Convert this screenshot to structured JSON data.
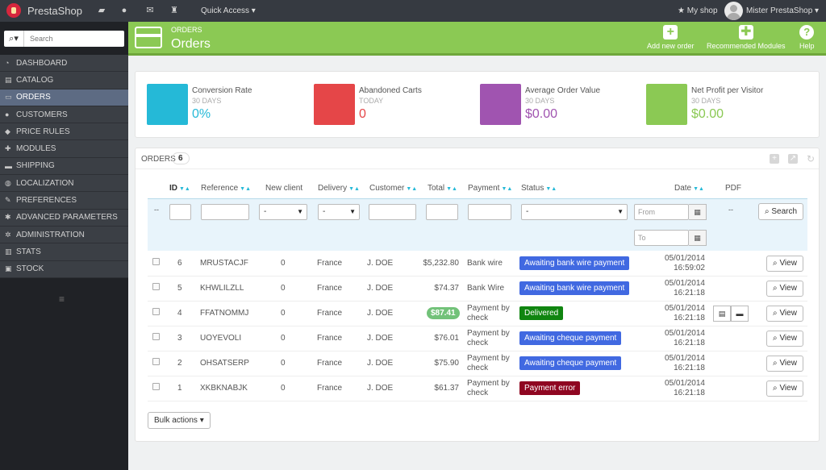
{
  "topbar": {
    "brand": "PrestaShop",
    "quick_access": "Quick Access ▾",
    "my_shop": "My shop",
    "user": "Mister PrestaShop ▾"
  },
  "sidebar": {
    "search_placeholder": "Search",
    "items": [
      {
        "label": "DASHBOARD",
        "icon": "speedometer-icon",
        "glyph": "◔"
      },
      {
        "label": "CATALOG",
        "icon": "catalog-icon",
        "glyph": "▤"
      },
      {
        "label": "ORDERS",
        "icon": "credit-card-icon",
        "glyph": "▭"
      },
      {
        "label": "CUSTOMERS",
        "icon": "users-icon",
        "glyph": "●"
      },
      {
        "label": "PRICE RULES",
        "icon": "tags-icon",
        "glyph": "◆"
      },
      {
        "label": "MODULES",
        "icon": "puzzle-icon",
        "glyph": "✚"
      },
      {
        "label": "SHIPPING",
        "icon": "truck-icon",
        "glyph": "▬"
      },
      {
        "label": "LOCALIZATION",
        "icon": "globe-icon",
        "glyph": "◍"
      },
      {
        "label": "PREFERENCES",
        "icon": "wrench-icon",
        "glyph": "✎"
      },
      {
        "label": "ADVANCED PARAMETERS",
        "icon": "cogs-icon",
        "glyph": "✱"
      },
      {
        "label": "ADMINISTRATION",
        "icon": "cog-icon",
        "glyph": "✲"
      },
      {
        "label": "STATS",
        "icon": "chart-icon",
        "glyph": "▥"
      },
      {
        "label": "STOCK",
        "icon": "archive-icon",
        "glyph": "▣"
      }
    ]
  },
  "header": {
    "breadcrumb": "ORDERS",
    "title": "Orders",
    "add_new": "Add new order",
    "recommended": "Recommended Modules",
    "help": "Help"
  },
  "kpis": [
    {
      "label": "Conversion Rate",
      "period": "30 DAYS",
      "value": "0%",
      "color": "#25b9d7"
    },
    {
      "label": "Abandoned Carts",
      "period": "TODAY",
      "value": "0",
      "color": "#e54648"
    },
    {
      "label": "Average Order Value",
      "period": "30 DAYS",
      "value": "$0.00",
      "color": "#a054b0"
    },
    {
      "label": "Net Profit per Visitor",
      "period": "30 DAYS",
      "value": "$0.00",
      "color": "#8bc954"
    }
  ],
  "orders": {
    "title": "ORDERS",
    "count": "6",
    "columns": {
      "id": "ID",
      "reference": "Reference",
      "new_client": "New client",
      "delivery": "Delivery",
      "customer": "Customer",
      "total": "Total",
      "payment": "Payment",
      "status": "Status",
      "date": "Date",
      "pdf": "PDF"
    },
    "filters": {
      "dash": "--",
      "select_default": "-",
      "from_placeholder": "From",
      "to_placeholder": "To",
      "search_label": "Search",
      "pdf_dash": "--"
    },
    "view_label": "View",
    "bulk_label": "Bulk actions ▾",
    "rows": [
      {
        "id": "6",
        "reference": "MRUSTACJF",
        "new_client": "0",
        "delivery": "France",
        "customer": "J. DOE",
        "total": "$5,232.80",
        "payment": "Bank wire",
        "payment2": "",
        "status": "Awaiting bank wire payment",
        "status_color": "#4169e1",
        "date": "05/01/2014",
        "time": "16:59:02",
        "highlight": false,
        "pdf": false
      },
      {
        "id": "5",
        "reference": "KHWLILZLL",
        "new_client": "0",
        "delivery": "France",
        "customer": "J. DOE",
        "total": "$74.37",
        "payment": "Bank Wire",
        "payment2": "",
        "status": "Awaiting bank wire payment",
        "status_color": "#4169e1",
        "date": "05/01/2014",
        "time": "16:21:18",
        "highlight": false,
        "pdf": false
      },
      {
        "id": "4",
        "reference": "FFATNOMMJ",
        "new_client": "0",
        "delivery": "France",
        "customer": "J. DOE",
        "total": "$87.41",
        "payment": "Payment by",
        "payment2": "check",
        "status": "Delivered",
        "status_color": "#108510",
        "date": "05/01/2014",
        "time": "16:21:18",
        "highlight": true,
        "pdf": true
      },
      {
        "id": "3",
        "reference": "UOYEVOLI",
        "new_client": "0",
        "delivery": "France",
        "customer": "J. DOE",
        "total": "$76.01",
        "payment": "Payment by",
        "payment2": "check",
        "status": "Awaiting cheque payment",
        "status_color": "#4169e1",
        "date": "05/01/2014",
        "time": "16:21:18",
        "highlight": false,
        "pdf": false
      },
      {
        "id": "2",
        "reference": "OHSATSERP",
        "new_client": "0",
        "delivery": "France",
        "customer": "J. DOE",
        "total": "$75.90",
        "payment": "Payment by",
        "payment2": "check",
        "status": "Awaiting cheque payment",
        "status_color": "#4169e1",
        "date": "05/01/2014",
        "time": "16:21:18",
        "highlight": false,
        "pdf": false
      },
      {
        "id": "1",
        "reference": "XKBKNABJK",
        "new_client": "0",
        "delivery": "France",
        "customer": "J. DOE",
        "total": "$61.37",
        "payment": "Payment by",
        "payment2": "check",
        "status": "Payment error",
        "status_color": "#8f0621",
        "date": "05/01/2014",
        "time": "16:21:18",
        "highlight": false,
        "pdf": false
      }
    ]
  }
}
